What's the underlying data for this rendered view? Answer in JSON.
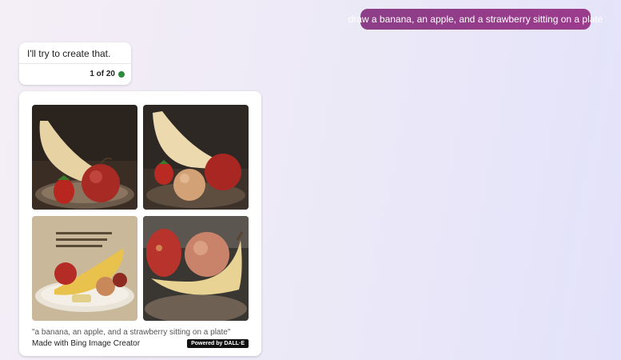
{
  "chat": {
    "user_prompt": "draw a banana, an apple, and a strawberry sitting on a plate",
    "bot_reply": "I'll try to create that.",
    "counter": "1 of 20",
    "status_color": "#2e8b3e"
  },
  "image_result": {
    "images": [
      {
        "alt": "banana, apple and strawberry on a dark plate"
      },
      {
        "alt": "banana, apples and strawberry on a plate"
      },
      {
        "alt": "banana, apple and fruit on a white plate with text above"
      },
      {
        "alt": "banana, apple and strawberry close-up on a plate"
      }
    ],
    "caption": "\"a banana, an apple, and a strawberry sitting on a plate\"",
    "made_with": "Made with Bing Image Creator",
    "badge": "Powered by DALL·E"
  },
  "colors": {
    "user_bubble": "#8c3e87",
    "badge_bg": "#111111"
  }
}
